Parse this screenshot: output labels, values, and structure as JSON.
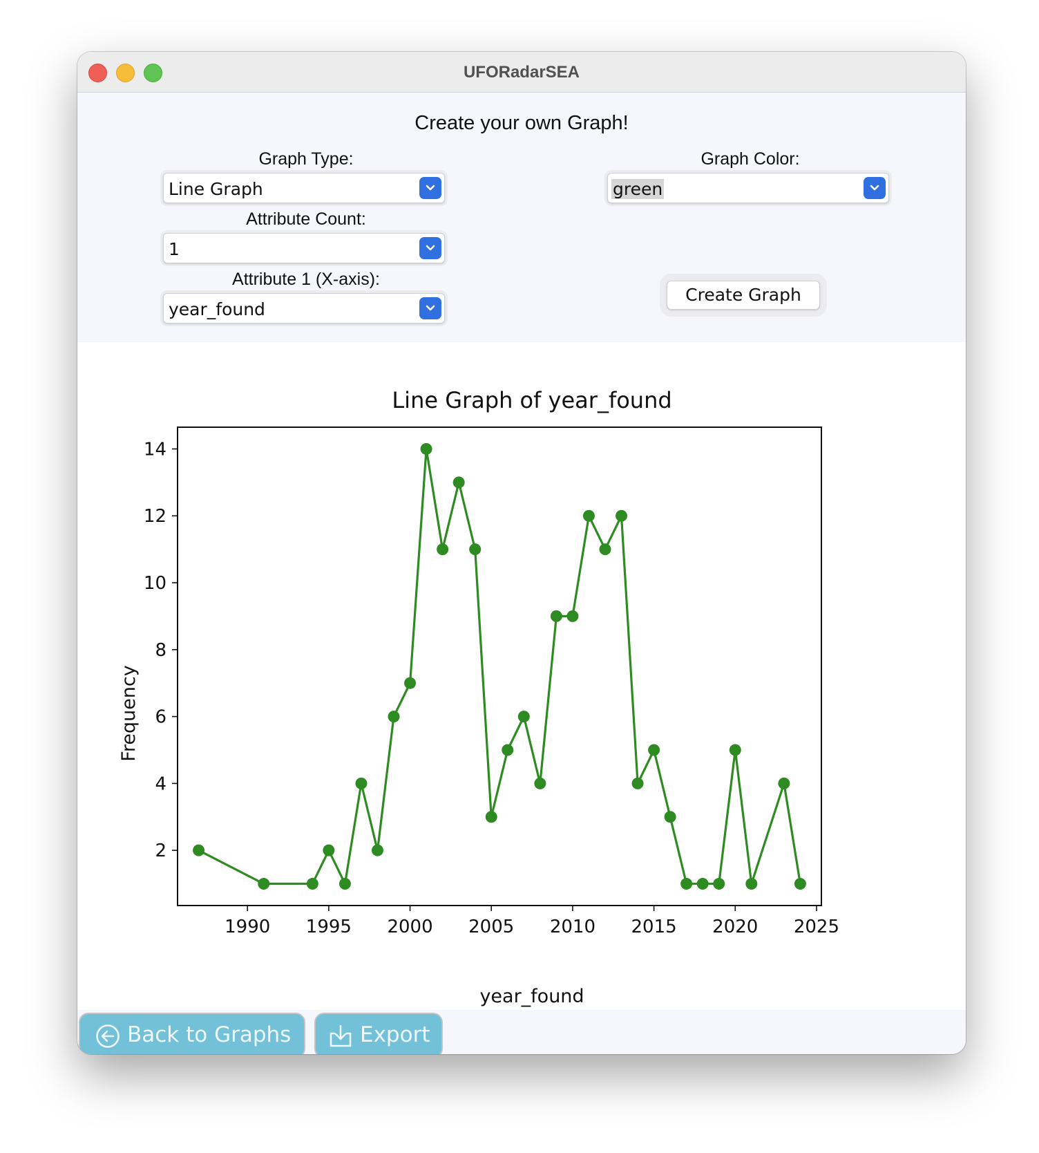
{
  "window": {
    "title": "UFORadarSEA"
  },
  "form": {
    "heading": "Create your own Graph!",
    "graph_type_label": "Graph Type:",
    "graph_type_value": "Line Graph",
    "graph_color_label": "Graph Color:",
    "graph_color_value": "green",
    "attribute_count_label": "Attribute Count:",
    "attribute_count_value": "1",
    "attribute1_label": "Attribute 1 (X-axis):",
    "attribute1_value": "year_found",
    "create_button": "Create Graph"
  },
  "footer": {
    "back_button": "Back to Graphs",
    "export_button": "Export"
  },
  "chart_data": {
    "type": "line",
    "title": "Line Graph of year_found",
    "xlabel": "year_found",
    "ylabel": "Frequency",
    "xlim": [
      1985.7,
      2025.3
    ],
    "ylim": [
      0.35,
      14.65
    ],
    "xticks": [
      1990,
      1995,
      2000,
      2005,
      2010,
      2015,
      2020,
      2025
    ],
    "yticks": [
      2,
      4,
      6,
      8,
      10,
      12,
      14
    ],
    "color": "#2e8b22",
    "x": [
      1987,
      1991,
      1994,
      1995,
      1996,
      1997,
      1998,
      1999,
      2000,
      2001,
      2002,
      2003,
      2004,
      2005,
      2006,
      2007,
      2008,
      2009,
      2010,
      2011,
      2012,
      2013,
      2014,
      2015,
      2016,
      2017,
      2018,
      2019,
      2020,
      2021,
      2023,
      2024
    ],
    "y": [
      2,
      1,
      1,
      2,
      1,
      4,
      2,
      6,
      7,
      14,
      11,
      13,
      11,
      3,
      5,
      6,
      4,
      9,
      9,
      12,
      11,
      12,
      4,
      5,
      3,
      1,
      1,
      1,
      5,
      1,
      4,
      1
    ],
    "grid": false
  }
}
